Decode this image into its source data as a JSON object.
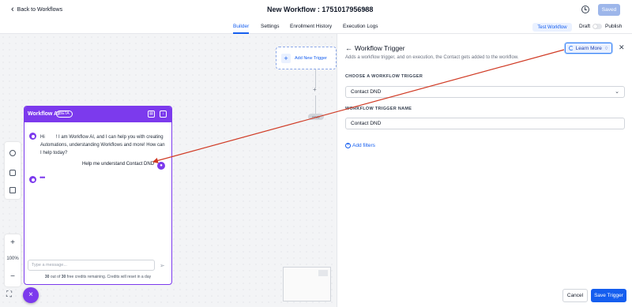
{
  "header": {
    "back_label": "Back to Workflows",
    "workflow_title": "New Workflow : 1751017956988",
    "saved_label": "Saved"
  },
  "tabs": [
    {
      "label": "Builder",
      "active": true
    },
    {
      "label": "Settings"
    },
    {
      "label": "Enrollment History"
    },
    {
      "label": "Execution Logs"
    }
  ],
  "toolbar": {
    "test_workflow_label": "Test Workflow",
    "draft_label": "Draft",
    "publish_label": "Publish"
  },
  "canvas": {
    "add_trigger_label": "Add New Trigger",
    "end_label": "END",
    "zoom_level": "100%",
    "zoom_in": "+",
    "zoom_out": "−"
  },
  "ai_panel": {
    "title": "Workflow AI",
    "badge": "BETA",
    "greeting_prefix": "Hi",
    "greeting_text": "! I am Workflow AI, and I can help you with creating Automations, understanding Workflows and more! How can I help today?",
    "user_message": "Help me understand Contact DND",
    "typing_indicator": "•••",
    "input_placeholder": "Type a message...",
    "credits_used": "30",
    "credits_total": "30",
    "credits_text_mid": " out of ",
    "credits_text_end": " free credits remaining. Credits will reset in a day",
    "accent_color": "#7c3aed"
  },
  "right_panel": {
    "title": "Workflow Trigger",
    "subtitle": "Adds a workflow trigger, and on execution, the Contact gets added to the workflow.",
    "learn_more_label": "Learn More",
    "choose_trigger_label": "CHOOSE A WORKFLOW TRIGGER",
    "selected_trigger": "Contact DND",
    "trigger_name_label": "WORKFLOW TRIGGER NAME",
    "trigger_name_value": "Contact DND",
    "add_filters_label": "Add filters",
    "cancel_label": "Cancel",
    "save_label": "Save Trigger",
    "primary_color": "#155eef"
  },
  "annotation": {
    "arrow_color": "#d03a24"
  }
}
